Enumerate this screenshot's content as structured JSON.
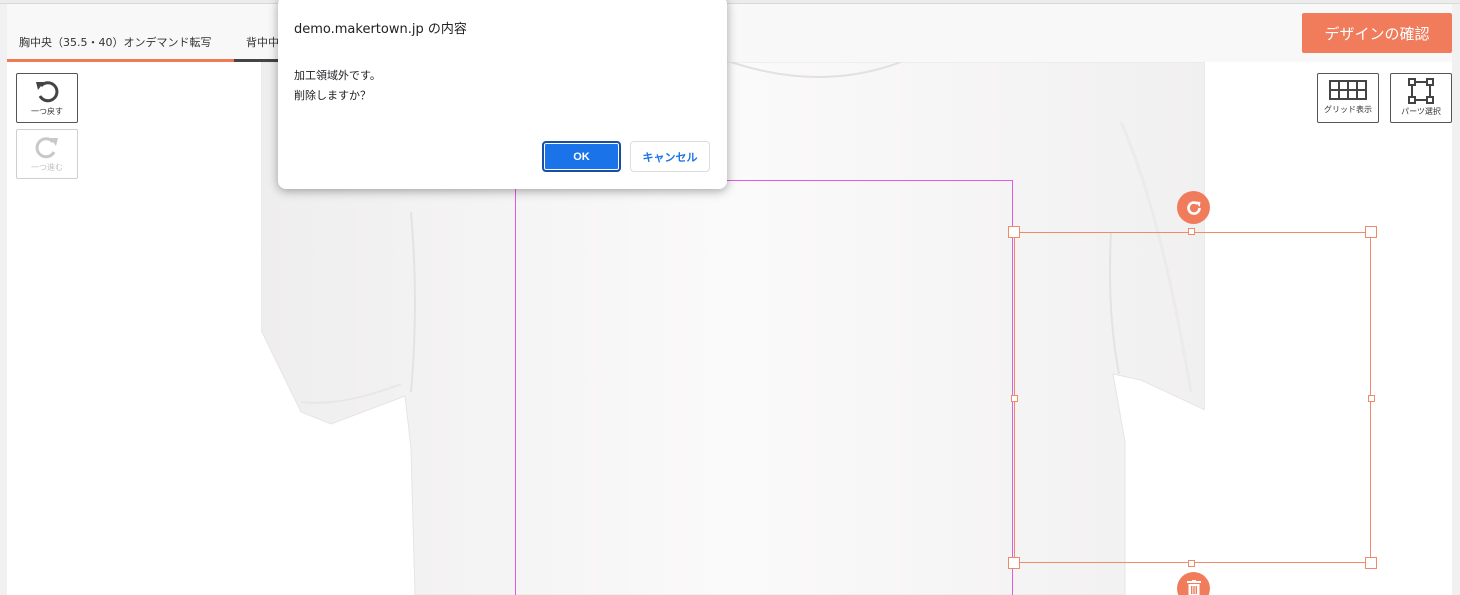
{
  "tabs": [
    {
      "label": "胸中央（35.5・40）オンデマンド転写",
      "active": true
    },
    {
      "label": "背中中央",
      "active": false
    }
  ],
  "header": {
    "confirm_label": "デザインの確認"
  },
  "history": {
    "undo_label": "一つ戻す",
    "redo_label": "一つ進む"
  },
  "view_tools": {
    "grid_label": "グリッド表示",
    "parts_label": "パーツ選択"
  },
  "dialog": {
    "title": "demo.makertown.jp の内容",
    "line1": "加工領域外です。",
    "line2": "削除しますか？",
    "ok_label": "OK",
    "cancel_label": "キャンセル"
  },
  "colors": {
    "accent": "#f07c5c",
    "print_area": "#e05de3",
    "dialog_ok": "#1a73e8"
  },
  "icons": [
    "undo-icon",
    "redo-icon",
    "grid-icon",
    "parts-select-icon",
    "rotate-icon",
    "trash-icon"
  ]
}
